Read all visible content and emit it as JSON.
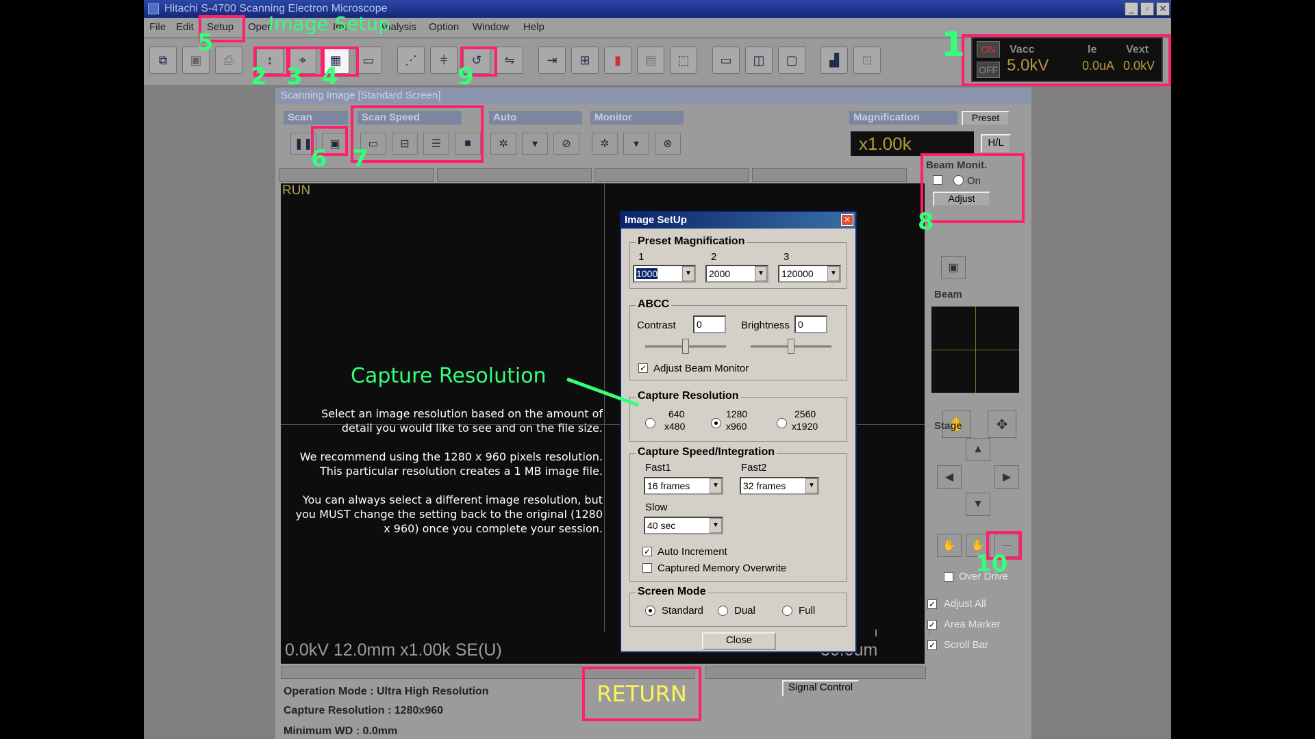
{
  "app": {
    "title": "Hitachi S-4700 Scanning Electron Microscope"
  },
  "menu": [
    "File",
    "Edit",
    "Setup",
    "Operation",
    "Image",
    "Analysis",
    "Option",
    "Window",
    "Help"
  ],
  "meter": {
    "on": "ON",
    "off": "OFF",
    "vacc_label": "Vacc",
    "vacc_value": "5.0kV",
    "ie_label": "Ie",
    "ie_value": "0.0uA",
    "vext_label": "Vext",
    "vext_value": "0.0kV"
  },
  "scan_window": {
    "title": "Scanning Image [Standard Screen]",
    "groups": {
      "scan": "Scan",
      "scan_speed": "Scan Speed",
      "auto": "Auto",
      "monitor": "Monitor",
      "magnification": "Magnification"
    },
    "preset_button": "Preset",
    "magnification": "x1.00k",
    "hl_button": "H/L",
    "run_label": "RUN",
    "footer_left": "0.0kV 12.0mm x1.00k SE(U)",
    "footer_right": "30.0um",
    "signal_control": "Signal Control"
  },
  "status": {
    "line1": "Operation Mode : Ultra High Resolution",
    "line2": "Capture Resolution : 1280x960",
    "line3": "Minimum WD : 0.0mm"
  },
  "right_panel": {
    "beam_monit": "Beam Monit.",
    "on_label": "On",
    "adjust": "Adjust",
    "beam": "Beam",
    "stage": "Stage",
    "over_drive": "Over Drive",
    "adjust_all": "Adjust All",
    "area_marker": "Area Marker",
    "scroll_bar": "Scroll Bar"
  },
  "dialog": {
    "title": "Image SetUp",
    "preset": {
      "legend": "Preset Magnification",
      "labels": [
        "1",
        "2",
        "3"
      ],
      "values": [
        "1000",
        "2000",
        "120000"
      ]
    },
    "abcc": {
      "legend": "ABCC",
      "contrast_label": "Contrast",
      "contrast_value": "0",
      "brightness_label": "Brightness",
      "brightness_value": "0",
      "adjust_beam_monitor": "Adjust Beam Monitor"
    },
    "capture_resolution": {
      "legend": "Capture Resolution",
      "options": [
        {
          "line1": "640",
          "line2": "x480"
        },
        {
          "line1": "1280",
          "line2": "x960"
        },
        {
          "line1": "2560",
          "line2": "x1920"
        }
      ],
      "selected": 1
    },
    "capture_speed": {
      "legend": "Capture Speed/Integration",
      "fast1_label": "Fast1",
      "fast1_value": "16 frames",
      "fast2_label": "Fast2",
      "fast2_value": "32 frames",
      "slow_label": "Slow",
      "slow_value": "40 sec",
      "auto_increment": "Auto Increment",
      "overwrite": "Captured Memory Overwrite"
    },
    "screen_mode": {
      "legend": "Screen Mode",
      "options": [
        "Standard",
        "Dual",
        "Full"
      ],
      "selected": 0
    },
    "close": "Close"
  },
  "annotations": {
    "image_setup": "Image Setup",
    "capture_resolution": "Capture Resolution",
    "numbers": [
      "1",
      "2",
      "3",
      "4",
      "5",
      "6",
      "7",
      "8",
      "9",
      "10"
    ],
    "return": "RETURN",
    "help_p1": "Select an image resolution based on the amount of detail you would like to see and on the file size.",
    "help_p2": "We recommend using the 1280 x 960 pixels resolution. This particular resolution creates a 1 MB image file.",
    "help_p3": "You can always select a different image resolution, but you MUST change the setting back to the original (1280 x 960) once you complete your session."
  },
  "colors": {
    "highlight": "#ff1f6e",
    "annotation": "#33ff78",
    "return_text": "#fff45a"
  }
}
